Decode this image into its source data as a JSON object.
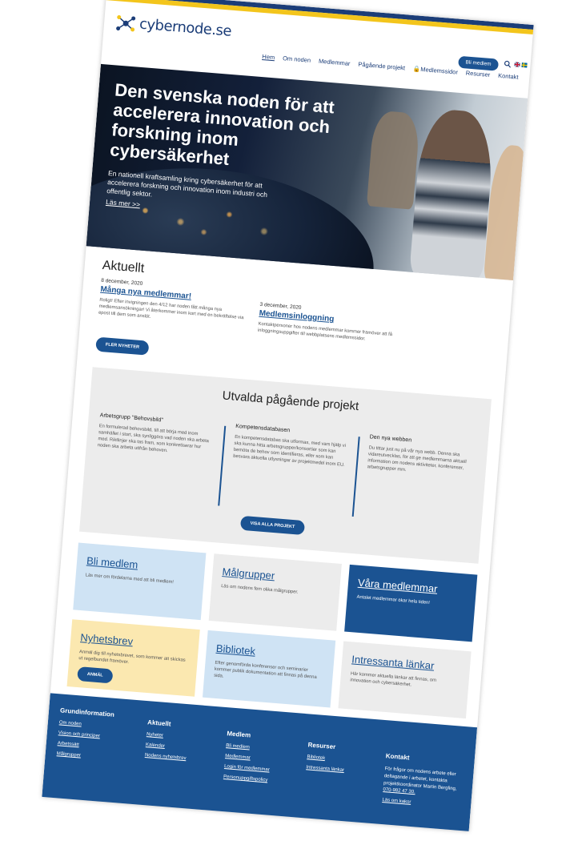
{
  "brand": {
    "name": "cybernode.se",
    "color": "#1b3d78",
    "accent": "#f3c51c"
  },
  "nav": {
    "items": [
      "Hem",
      "Om noden",
      "Medlemmar",
      "Pågående projekt",
      "Medlemssidor",
      "Resurser",
      "Kontakt"
    ],
    "join_label": "Bli medlem",
    "search_icon": "search-icon",
    "lock_icon": "lock-icon"
  },
  "hero": {
    "title": "Den svenska noden för att accelerera innovation och forskning inom cybersäkerhet",
    "subtitle": "En nationell kraftsamling kring cybersäkerhet för att accelerera forskning och innovation inom industri och offentlig sektor.",
    "more": "Läs mer >>"
  },
  "news": {
    "title": "Aktuellt",
    "items": [
      {
        "date": "8 december, 2020",
        "headline": "Många nya medlemmar!",
        "text": "Roligt! Efter invigningen den 4/12 har noden fått många nya medlemsansökningar! Vi återkommer inom kort med en bekräftelse via epost till dem som anslöt."
      },
      {
        "date": "3 december, 2020",
        "headline": "Medlemsinloggning",
        "text": "Kontaktpersoner hos nodens medlemmar kommer framöver att få inloggningsuppgifter till webbplatsens medlemssidor."
      }
    ],
    "more_button": "FLER NYHETER"
  },
  "projects": {
    "title": "Utvalda pågående projekt",
    "items": [
      {
        "title": "Arbetsgrupp \"Behovsbild\"",
        "text": "En formulerad behovsbild, till att börja med inom samhället i stort, ska synliggöra vad noden ska arbeta med. Riktlinjer ska tas fram, som konkretiserar hur noden ska arbeta utifrån behoven."
      },
      {
        "title": "Kompetensdatabasen",
        "text": "En kompetensdatabas ska utformas, med vars hjälp vi ska kunna hitta arbetsgrupper/konsortier som kan bemöta de behov som identifieras, eller som kan besvara aktuella utlysningar av projektmedel inom EU."
      },
      {
        "title": "Den nya webben",
        "text": "Du tittar just nu på vår nya webb. Denna ska vidareutvecklas, för att ge medlemmarna aktuell information om nodens aktiviteter, konferenser, arbetsgrupper mm."
      }
    ],
    "all_button": "VISA ALLA PROJEKT"
  },
  "tiles": [
    {
      "title": "Bli medlem",
      "text": "Läs mer om fördelarna med att bli medlem!",
      "bg": "#cfe3f4",
      "fg": "#1b5392"
    },
    {
      "title": "Målgrupper",
      "text": "Läs om nodens fem olika målgrupper.",
      "bg": "#ececec",
      "fg": "#1b5392"
    },
    {
      "title": "Våra medlemmar",
      "text": "Antalet medlemmar ökar hela tiden!",
      "bg": "#1b5392",
      "fg": "#ffffff"
    },
    {
      "title": "Nyhetsbrev",
      "text": "Anmäl dig till nyhetsbrevet, som kommer att skickas ut regelbundet framöver.",
      "bg": "#fbe8b0",
      "fg": "#1b5392",
      "button": "ANMÄL"
    },
    {
      "title": "Bibliotek",
      "text": "Efter genomförda konferenser och seminarier kommer publik dokumentation att finnas på denna sida.",
      "bg": "#cfe3f4",
      "fg": "#1b5392"
    },
    {
      "title": "Intressanta länkar",
      "text": "Här kommer aktuella länkar att finnas, om innovation och cybersäkerhet.",
      "bg": "#ececec",
      "fg": "#1b5392"
    }
  ],
  "footer": {
    "columns": [
      {
        "title": "Grundinformation",
        "links": [
          "Om noden",
          "Vision och principer",
          "Arbetssätt",
          "Målgrupper"
        ]
      },
      {
        "title": "Aktuellt",
        "links": [
          "Nyheter",
          "Kalender",
          "Nodens nyhetsbrev"
        ]
      },
      {
        "title": "Medlem",
        "links": [
          "Bli medlem",
          "Medlemmar",
          "Login för medlemmar",
          "Personuppgiftspolicy"
        ]
      },
      {
        "title": "Resurser",
        "links": [
          "Bibliotek",
          "Intressanta länkar"
        ]
      }
    ],
    "contact": {
      "title": "Kontakt",
      "text": "För frågor om nodens arbete eller deltagande i arbetet, kontakta projektkoordinator Martin Bergling,",
      "phone": "070-982 47 30.",
      "cookies": "Läs om kakor"
    }
  }
}
